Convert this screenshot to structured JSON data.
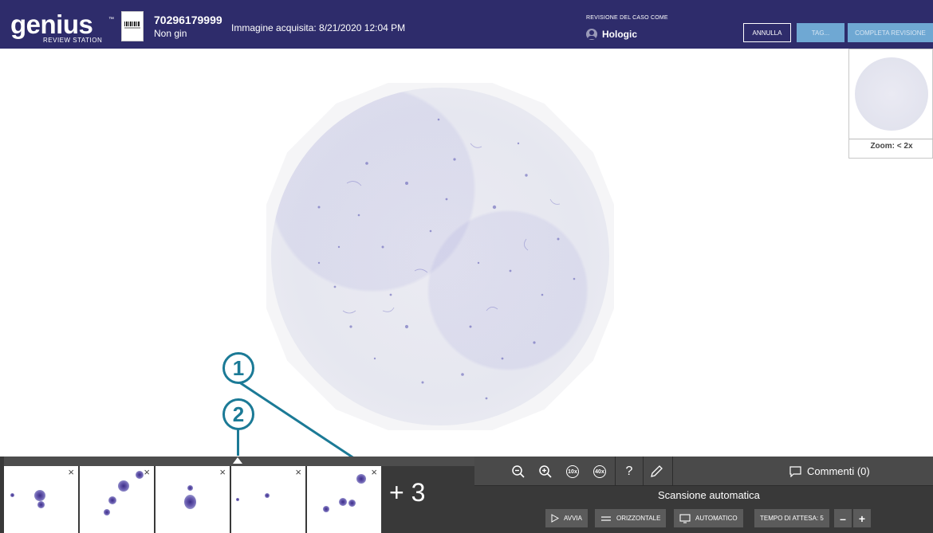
{
  "header": {
    "logo": {
      "word": "genius",
      "tm": "™",
      "sub": "REVIEW STATION"
    },
    "case_id": "70296179999",
    "case_type": "Non gin",
    "acquired": "Immagine acquisita: 8/21/2020 12:04 PM",
    "review_as_label": "REVISIONE DEL CASO COME",
    "reviewer_name": "Hologic",
    "buttons": {
      "cancel": "ANNULLA",
      "tag": "TAG...",
      "complete": "COMPLETA REVISIONE"
    }
  },
  "minimap": {
    "zoom_label": "Zoom: < 2x"
  },
  "callouts": {
    "one": "1",
    "two": "2"
  },
  "gallery": {
    "more_label": "+ 3",
    "close_glyph": "×"
  },
  "toolbar": {
    "zoom_out_icon": "zoom-out-icon",
    "zoom_in_icon": "zoom-in-icon",
    "zoom_10x": "10x",
    "zoom_40x": "40x",
    "help": "?",
    "comments": "Commenti (0)"
  },
  "autoscan": {
    "title": "Scansione automatica",
    "start": "AVVIA",
    "horizontal": "ORIZZONTALE",
    "automatic": "AUTOMATICO",
    "wait_time": "TEMPO DI ATTESA: 5",
    "minus": "–",
    "plus": "+"
  },
  "colors": {
    "header_bg": "#2e2c6b",
    "accent_button": "#6fa8d3",
    "callout": "#1b7a96",
    "toolbar_bg": "#393939"
  }
}
